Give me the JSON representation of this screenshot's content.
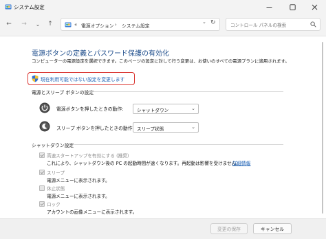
{
  "window": {
    "title": "システム設定",
    "icon": "control-panel-icon"
  },
  "nav": {
    "back": "←",
    "forward": "→",
    "recent": "⌄",
    "up": "↑",
    "breadcrumb_prefix": "«",
    "breadcrumb": [
      "電源オプション",
      "システム設定"
    ],
    "separator": "›",
    "search_placeholder": "コントロール パネルの検索"
  },
  "main": {
    "heading": "電源ボタンの定義とパスワード保護の有効化",
    "description": "コンピューターの電源設定を選択できます。このページの設定に対して行う変更は、お使いのすべての電源プランに適用されます。",
    "change_link": "現在利用可能ではない設定を変更します",
    "power_section_title": "電源とスリープ ボタンの設定",
    "power_rows": [
      {
        "label": "電源ボタンを押したときの動作:",
        "value": "シャットダウン",
        "icon": "power-icon"
      },
      {
        "label": "スリープ ボタンを押したときの動作:",
        "value": "スリープ状態",
        "icon": "sleep-icon"
      }
    ],
    "shutdown_section_title": "シャットダウン設定",
    "shutdown_options": [
      {
        "label": "高速スタートアップを有効にする (推奨)",
        "checked": true,
        "description": "これにより、シャットダウン後の PC の起動時間が速くなります。再起動は影響を受けません。",
        "link": "詳細情報"
      },
      {
        "label": "スリープ",
        "checked": true,
        "description": "電源メニューに表示されます。"
      },
      {
        "label": "休止状態",
        "checked": false,
        "description": "電源メニューに表示されます。"
      },
      {
        "label": "ロック",
        "checked": true,
        "description": "アカウントの画像メニューに表示されます。"
      }
    ]
  },
  "footer": {
    "save_label": "変更の保存",
    "cancel_label": "キャンセル"
  },
  "colors": {
    "heading": "#1f4e8c",
    "link": "#1a5fb4",
    "highlight": "#d9302b"
  }
}
